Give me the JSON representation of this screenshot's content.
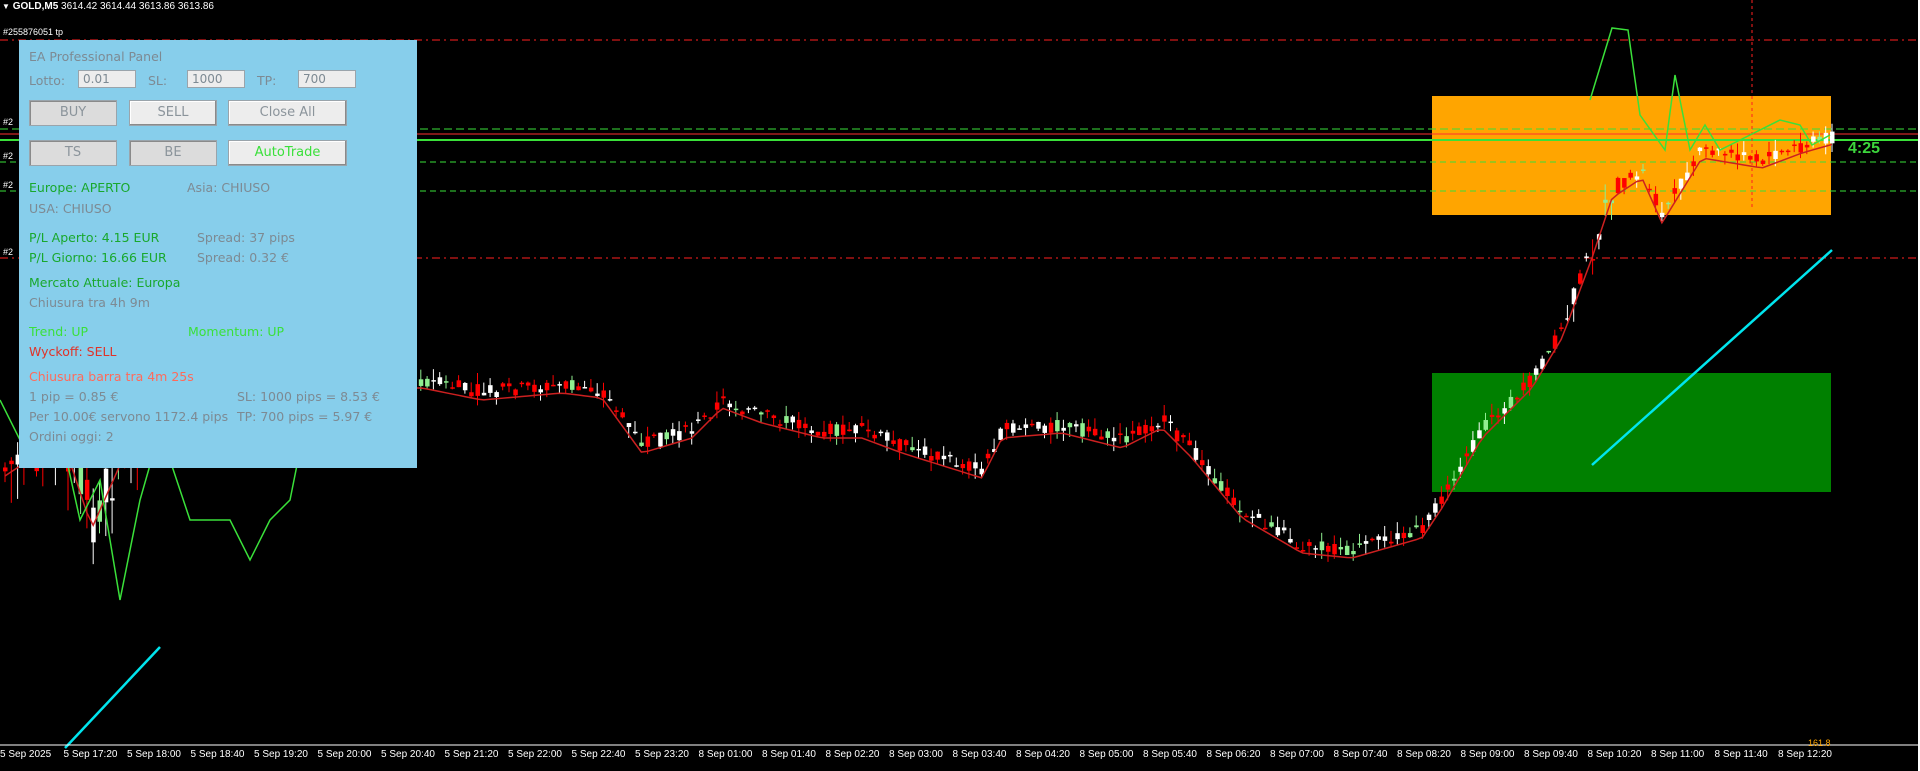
{
  "header": {
    "arrow_icon": "triangle-down-icon",
    "symbol": "GOLD,M5",
    "ohlc": "3614.42 3614.44 3613.86 3613.86"
  },
  "order_tags": {
    "first": "#255876051 tp",
    "others": [
      "#2",
      "#2",
      "#2",
      "#2"
    ]
  },
  "bar_timer": "4:25",
  "fib_label_bottom": "161.8",
  "colors": {
    "bull": "#ffffff",
    "bear": "#ff0000",
    "bull_doji": "#90ee90",
    "ma": "#cc2020",
    "panel_bg": "#87ceeb",
    "zone_supply": "#ffa500",
    "zone_demand": "#008000",
    "cyan_line": "#00e5ee",
    "lime_line": "#3ae03a"
  },
  "panel": {
    "title": "EA Professional Panel",
    "lot_label": "Lotto:",
    "lot_value": "0.01",
    "sl_label": "SL:",
    "sl_value": "1000",
    "tp_label": "TP:",
    "tp_value": "700",
    "buttons": {
      "buy": "BUY",
      "sell": "SELL",
      "close_all": "Close All",
      "ts": "TS",
      "be": "BE",
      "autotrade": "AutoTrade"
    },
    "europe": "Europe: APERTO",
    "asia": "Asia: CHIUSO",
    "usa": "USA: CHIUSO",
    "pl_open": "P/L Aperto: 4.15 EUR",
    "spread_pips": "Spread: 37 pips",
    "pl_day": "P/L Giorno: 16.66 EUR",
    "spread_eur": "Spread: 0.32 €",
    "market_now": "Mercato Attuale: Europa",
    "closing_in": "Chiusura tra 4h 9m",
    "trend": "Trend: UP",
    "momentum": "Momentum: UP",
    "wyckoff": "Wyckoff: SELL",
    "bar_close": "Chiusura barra tra 4m 25s",
    "pip_value": "1 pip = 0.85 €",
    "sl_info": "SL: 1000 pips = 8.53 €",
    "need": "Per 10.00€ servono 1172.4 pips",
    "tp_info": "TP: 700 pips = 5.97 €",
    "orders_today": "Ordini oggi: 2"
  },
  "time_axis": {
    "labels": [
      "5 Sep 2025",
      "5 Sep 17:20",
      "5 Sep 18:00",
      "5 Sep 18:40",
      "5 Sep 19:20",
      "5 Sep 20:00",
      "5 Sep 20:40",
      "5 Sep 21:20",
      "5 Sep 22:00",
      "5 Sep 22:40",
      "5 Sep 23:20",
      "8 Sep 01:00",
      "8 Sep 01:40",
      "8 Sep 02:20",
      "8 Sep 03:00",
      "8 Sep 03:40",
      "8 Sep 04:20",
      "8 Sep 05:00",
      "8 Sep 05:40",
      "8 Sep 06:20",
      "8 Sep 07:00",
      "8 Sep 07:40",
      "8 Sep 08:20",
      "8 Sep 09:00",
      "8 Sep 09:40",
      "8 Sep 10:20",
      "8 Sep 11:00",
      "8 Sep 11:40",
      "8 Sep 12:20"
    ]
  }
}
